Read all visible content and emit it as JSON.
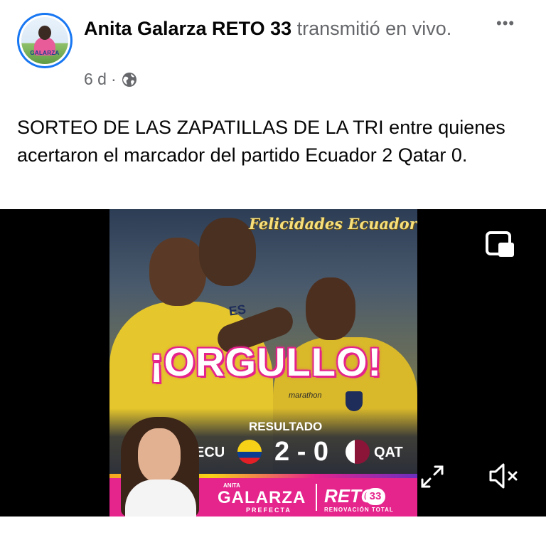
{
  "post": {
    "author": "Anita Galarza RETO 33",
    "action": "transmitió en vivo.",
    "time": "6 d",
    "separator": "·",
    "privacy_icon": "globe-icon",
    "more_icon": "more-options-icon",
    "more_label": "•••",
    "text": "SORTEO DE LAS ZAPATILLAS DE LA TRI entre quienes  acertaron el marcador  del partido Ecuador 2 Qatar 0."
  },
  "avatar": {
    "label": "GALARZA"
  },
  "video": {
    "thumbnail": {
      "felicidades": "Felicidades Ecuador",
      "headline": "¡ORGULLO!",
      "result_label": "RESULTADO",
      "team_left": "ECU",
      "team_right": "QAT",
      "score": "2 - 0",
      "jersey_text": "ES",
      "sponsor_text": "marathon",
      "brand_top": "ANITA",
      "brand_name": "GALARZA",
      "brand_role": "PREFECTA",
      "reto_label": "RETO",
      "reto_number": "33",
      "reto_sub": "RENOVACIÓN TOTAL"
    },
    "controls": {
      "pip_icon": "picture-in-picture-icon",
      "expand_icon": "fullscreen-expand-icon",
      "mute_icon": "muted-speaker-icon"
    }
  },
  "colors": {
    "facebook_blue": "#1877f2",
    "secondary_text": "#65676b",
    "brand_pink": "#e5248c",
    "ecuador_yellow": "#f7d117"
  }
}
